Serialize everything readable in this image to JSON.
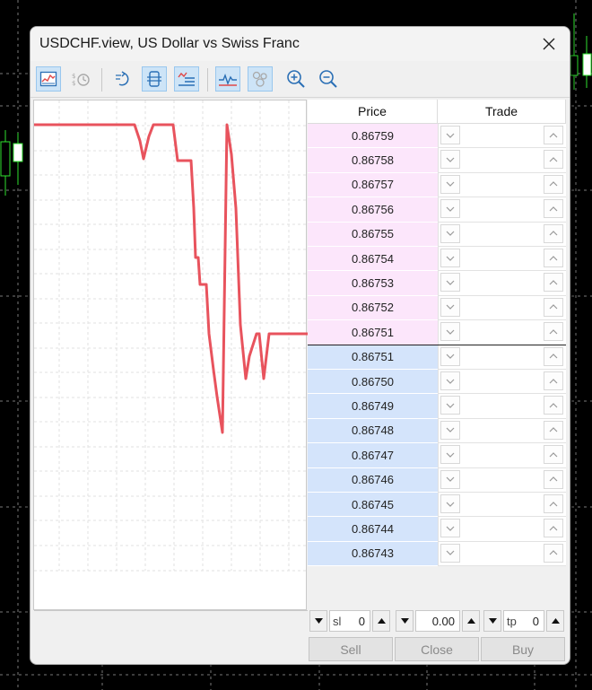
{
  "window": {
    "title": "USDCHF.view, US Dollar vs Swiss Franc"
  },
  "toolbar": {
    "buttons": [
      {
        "icon": "tick-chart-icon",
        "active": true
      },
      {
        "icon": "history-ticks-icon",
        "active": false
      },
      {
        "icon": "auto-scroll-icon",
        "active": false
      },
      {
        "icon": "center-price-icon",
        "active": true
      },
      {
        "icon": "depth-list-icon",
        "active": true
      },
      {
        "icon": "tick-line-icon",
        "active": true
      },
      {
        "icon": "volume-dots-icon",
        "active": true
      },
      {
        "icon": "zoom-in-icon",
        "active": false
      },
      {
        "icon": "zoom-out-icon",
        "active": false
      }
    ]
  },
  "table": {
    "price_header": "Price",
    "trade_header": "Trade",
    "ask_prices": [
      "0.86759",
      "0.86758",
      "0.86757",
      "0.86756",
      "0.86755",
      "0.86754",
      "0.86753",
      "0.86752",
      "0.86751"
    ],
    "bid_prices": [
      "0.86751",
      "0.86750",
      "0.86749",
      "0.86748",
      "0.86747",
      "0.86746",
      "0.86745",
      "0.86744",
      "0.86743"
    ]
  },
  "order": {
    "sl_label": "sl",
    "sl_value": "0",
    "volume_value": "0.00",
    "tp_label": "tp",
    "tp_value": "0"
  },
  "actions": {
    "sell": "Sell",
    "close": "Close",
    "buy": "Buy"
  },
  "colors": {
    "ask_bg": "#fce6fb",
    "bid_bg": "#d4e4fb",
    "tick_line": "#e8535d"
  }
}
